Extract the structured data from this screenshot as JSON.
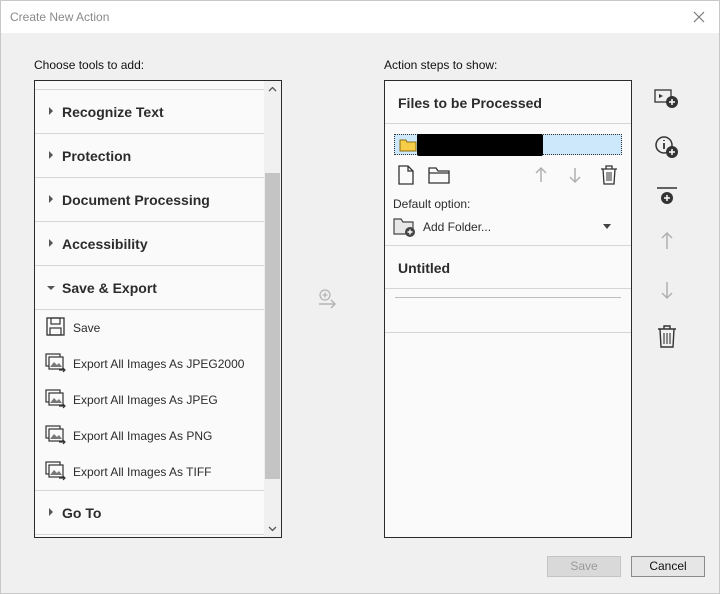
{
  "window": {
    "title": "Create New Action"
  },
  "left_panel": {
    "label": "Choose tools to add:",
    "groups": [
      {
        "label": "Recognize Text",
        "expanded": false
      },
      {
        "label": "Protection",
        "expanded": false
      },
      {
        "label": "Document Processing",
        "expanded": false
      },
      {
        "label": "Accessibility",
        "expanded": false
      },
      {
        "label": "Save & Export",
        "expanded": true,
        "items": [
          {
            "label": "Save",
            "icon": "save-icon"
          },
          {
            "label": "Export All Images As JPEG2000",
            "icon": "export-images-icon"
          },
          {
            "label": "Export All Images As JPEG",
            "icon": "export-images-icon"
          },
          {
            "label": "Export All Images As PNG",
            "icon": "export-images-icon"
          },
          {
            "label": "Export All Images As TIFF",
            "icon": "export-images-icon"
          }
        ]
      },
      {
        "label": "Go To",
        "expanded": false
      }
    ]
  },
  "right_panel": {
    "label": "Action steps to show:",
    "files_section_title": "Files to be Processed",
    "default_option_label": "Default option:",
    "default_option_value": "Add Folder...",
    "untitled_section_title": "Untitled"
  },
  "buttons": {
    "save": "Save",
    "cancel": "Cancel"
  },
  "colors": {
    "dialog_bg": "#f0f0f0",
    "panel_bg": "#fafafa",
    "selection_bg": "#cde8fb",
    "disabled_text": "#9a9a9a"
  }
}
